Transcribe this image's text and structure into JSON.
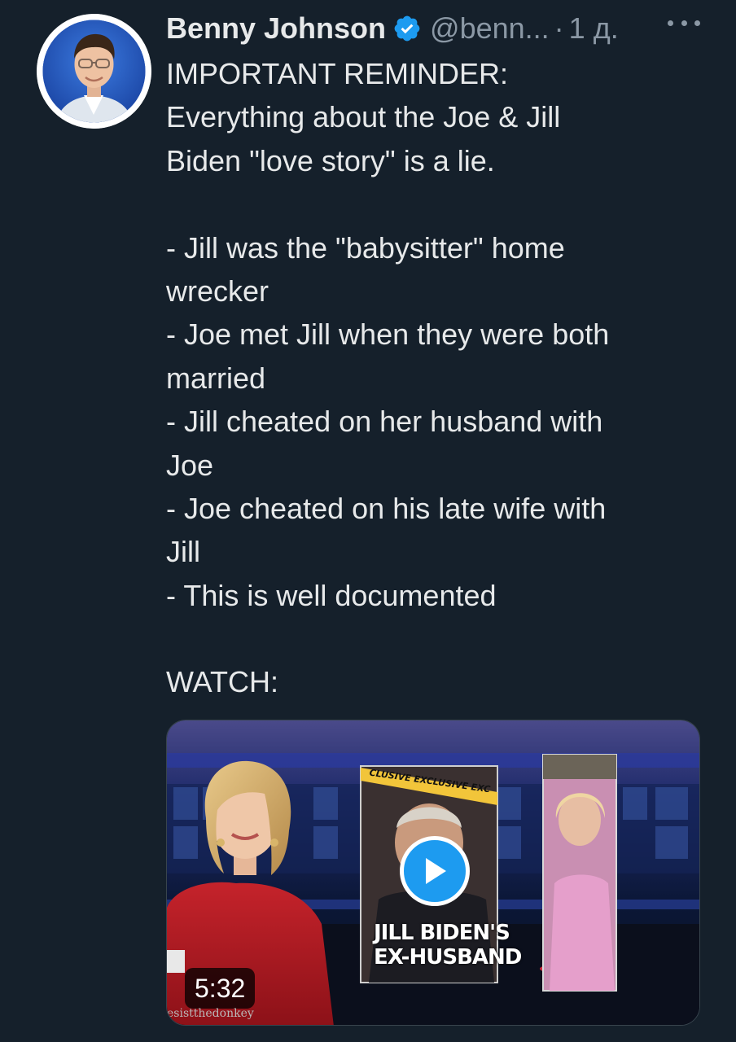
{
  "author": {
    "name": "Benny Johnson",
    "handle": "@benn...",
    "separator": "·",
    "time": "1 д.",
    "verified": true,
    "avatar_icon": "profile-photo"
  },
  "tweet": {
    "lines": [
      "IMPORTANT REMINDER:",
      "Everything about the Joe & Jill",
      "Biden \"love story\" is a lie.",
      "",
      "- Jill was the \"babysitter\" home",
      "wrecker",
      "- Joe met Jill when they were both",
      "married",
      "- Jill cheated on her husband with",
      "Joe",
      "- Joe cheated on his late wife with",
      "Jill",
      "- This is well documented",
      "",
      "WATCH:"
    ]
  },
  "media": {
    "duration": "5:32",
    "caption_line1": "JILL BIDEN'S",
    "caption_line2": "EX-HUSBAND",
    "banner": "CLUSIVE EXCLUSIVE EXCL",
    "watermark": "esistthedonkey",
    "play_icon": "play-icon"
  },
  "colors": {
    "background": "#15202b",
    "text_primary": "#e7e9ea",
    "text_secondary": "#8b98a5",
    "verified_badge": "#1d9bf0",
    "play_button": "#1d9bf0"
  }
}
